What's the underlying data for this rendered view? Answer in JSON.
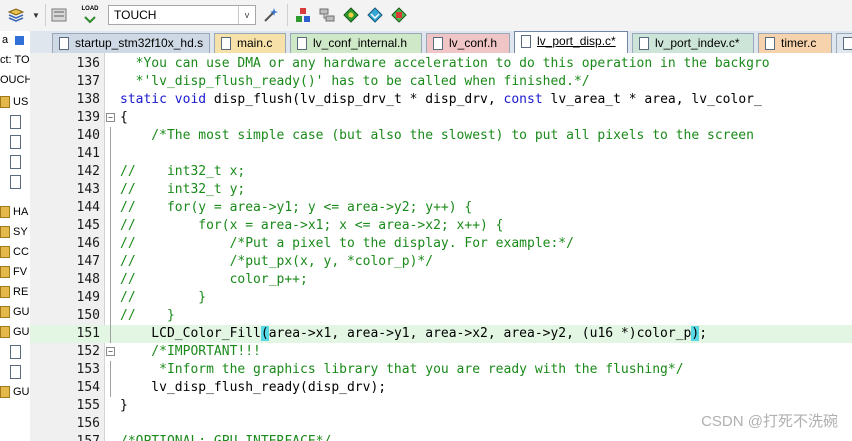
{
  "toolbar": {
    "load_label": "LOAD",
    "target_value": "TOUCH",
    "target_arrow": "v"
  },
  "sidebar": {
    "rows": [
      "a",
      "ct: TO",
      "OUCH",
      "US",
      "",
      "",
      "",
      "",
      "HA",
      "SY",
      "CC",
      "FV",
      "RE",
      "GU",
      "GU",
      "",
      "",
      "GU"
    ]
  },
  "tabs": [
    {
      "label": "startup_stm32f10x_hd.s",
      "color": "#cfd9e5"
    },
    {
      "label": "main.c",
      "color": "#f6e2a8"
    },
    {
      "label": "lv_conf_internal.h",
      "color": "#cfe8c8"
    },
    {
      "label": "lv_conf.h",
      "color": "#f0c5c5"
    },
    {
      "label": "lv_port_disp.c*",
      "color": "#ffffff"
    },
    {
      "label": "lv_port_indev.c*",
      "color": "#cde5d8"
    },
    {
      "label": "timer.c",
      "color": "#f7d3ad"
    }
  ],
  "code_lines": [
    {
      "n": "136",
      "code": "  *You can use DMA or any hardware acceleration to do this operation in the backgro"
    },
    {
      "n": "137",
      "code": "  *'lv_disp_flush_ready()' has to be called when finished.*/"
    },
    {
      "n": "138",
      "code": "static void disp_flush(lv_disp_drv_t * disp_drv, const lv_area_t * area, lv_color_"
    },
    {
      "n": "139",
      "code": "{"
    },
    {
      "n": "140",
      "code": "    /*The most simple case (but also the slowest) to put all pixels to the screen"
    },
    {
      "n": "141",
      "code": ""
    },
    {
      "n": "142",
      "code": "//    int32_t x;"
    },
    {
      "n": "143",
      "code": "//    int32_t y;"
    },
    {
      "n": "144",
      "code": "//    for(y = area->y1; y <= area->y2; y++) {"
    },
    {
      "n": "145",
      "code": "//        for(x = area->x1; x <= area->x2; x++) {"
    },
    {
      "n": "146",
      "code": "//            /*Put a pixel to the display. For example:*/"
    },
    {
      "n": "147",
      "code": "//            /*put_px(x, y, *color_p)*/"
    },
    {
      "n": "148",
      "code": "//            color_p++;"
    },
    {
      "n": "149",
      "code": "//        }"
    },
    {
      "n": "150",
      "code": "//    }"
    },
    {
      "n": "151",
      "code": "    LCD_Color_Fill(area->x1, area->y1, area->x2, area->y2, (u16 *)color_p);"
    },
    {
      "n": "152",
      "code": "    /*IMPORTANT!!!"
    },
    {
      "n": "153",
      "code": "     *Inform the graphics library that you are ready with the flushing*/"
    },
    {
      "n": "154",
      "code": "    lv_disp_flush_ready(disp_drv);"
    },
    {
      "n": "155",
      "code": "}"
    },
    {
      "n": "156",
      "code": ""
    },
    {
      "n": "157",
      "code": "/*OPTIONAL: GPU INTERFACE*/"
    }
  ],
  "watermark": "CSDN @打死不洗碗"
}
